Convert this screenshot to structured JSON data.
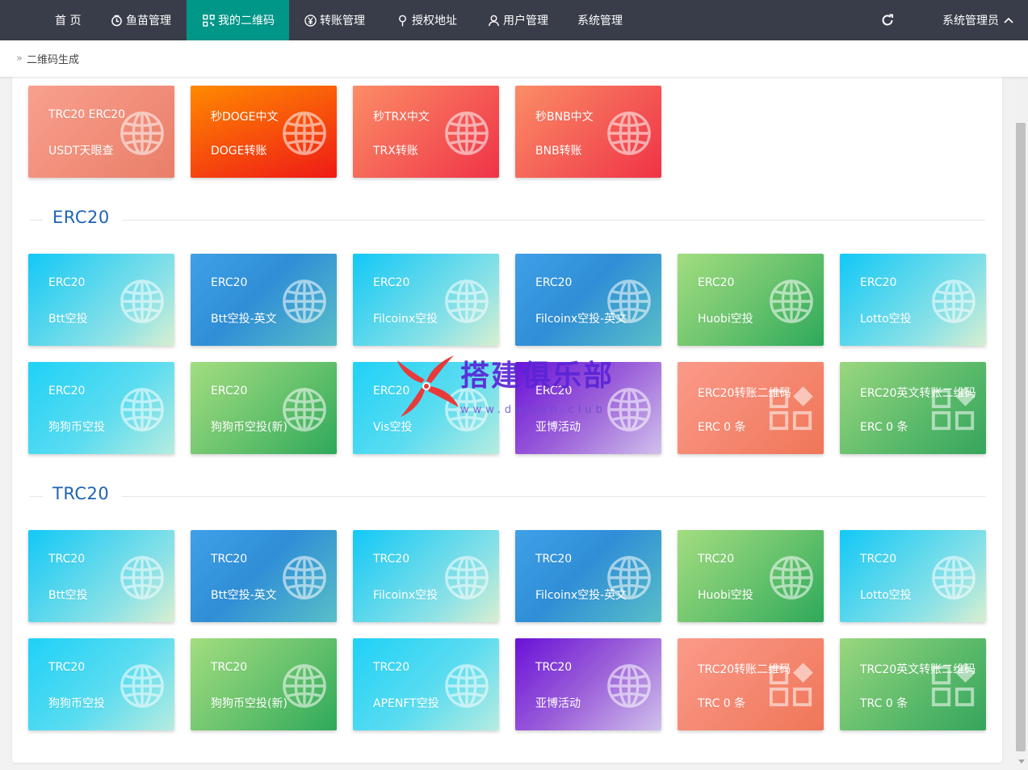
{
  "nav": {
    "items": [
      {
        "label": "首 页",
        "icon": ""
      },
      {
        "label": "鱼苗管理",
        "icon": "clock-icon"
      },
      {
        "label": "我的二维码",
        "icon": "qrcode-icon"
      },
      {
        "label": "转账管理",
        "icon": "yen-icon"
      },
      {
        "label": "授权地址",
        "icon": "location-icon"
      },
      {
        "label": "用户管理",
        "icon": "user-icon"
      },
      {
        "label": "系统管理",
        "icon": ""
      }
    ],
    "user": "系统管理员",
    "active_color": "#009688",
    "bg_color": "#393d49"
  },
  "breadcrumb": "二维码生成",
  "top_cards": [
    {
      "l1": "TRC20 ERC20",
      "l2": "USDT天眼查"
    },
    {
      "l1": "秒DOGE中文",
      "l2": "DOGE转账"
    },
    {
      "l1": "秒TRX中文",
      "l2": "TRX转账"
    },
    {
      "l1": "秒BNB中文",
      "l2": "BNB转账"
    }
  ],
  "sections": [
    {
      "title": "ERC20",
      "cards": [
        {
          "l1": "ERC20",
          "l2": "Btt空投"
        },
        {
          "l1": "ERC20",
          "l2": "Btt空投-英文"
        },
        {
          "l1": "ERC20",
          "l2": "Filcoinx空投"
        },
        {
          "l1": "ERC20",
          "l2": "Filcoinx空投-英文"
        },
        {
          "l1": "ERC20",
          "l2": "Huobi空投"
        },
        {
          "l1": "ERC20",
          "l2": "Lotto空投"
        },
        {
          "l1": "ERC20",
          "l2": "狗狗币空投"
        },
        {
          "l1": "ERC20",
          "l2": "狗狗币空投(新)"
        },
        {
          "l1": "ERC20",
          "l2": "Vis空投"
        },
        {
          "l1": "ERC20",
          "l2": "亚博活动"
        },
        {
          "l1": "ERC20转账二维码",
          "l2": "ERC 0 条"
        },
        {
          "l1": "ERC20英文转账二维码",
          "l2": "ERC 0 条"
        }
      ]
    },
    {
      "title": "TRC20",
      "cards": [
        {
          "l1": "TRC20",
          "l2": "Btt空投"
        },
        {
          "l1": "TRC20",
          "l2": "Btt空投-英文"
        },
        {
          "l1": "TRC20",
          "l2": "Filcoinx空投"
        },
        {
          "l1": "TRC20",
          "l2": "Filcoinx空投-英文"
        },
        {
          "l1": "TRC20",
          "l2": "Huobi空投"
        },
        {
          "l1": "TRC20",
          "l2": "Lotto空投"
        },
        {
          "l1": "TRC20",
          "l2": "狗狗币空投"
        },
        {
          "l1": "TRC20",
          "l2": "狗狗币空投(新)"
        },
        {
          "l1": "TRC20",
          "l2": "APENFT空投"
        },
        {
          "l1": "TRC20",
          "l2": "亚博活动"
        },
        {
          "l1": "TRC20转账二维码",
          "l2": "TRC 0 条"
        },
        {
          "l1": "TRC20英文转账二维码",
          "l2": "TRC 0 条"
        }
      ]
    }
  ],
  "watermark": {
    "text": "搭建俱乐部",
    "url": "www.dajian.club"
  }
}
